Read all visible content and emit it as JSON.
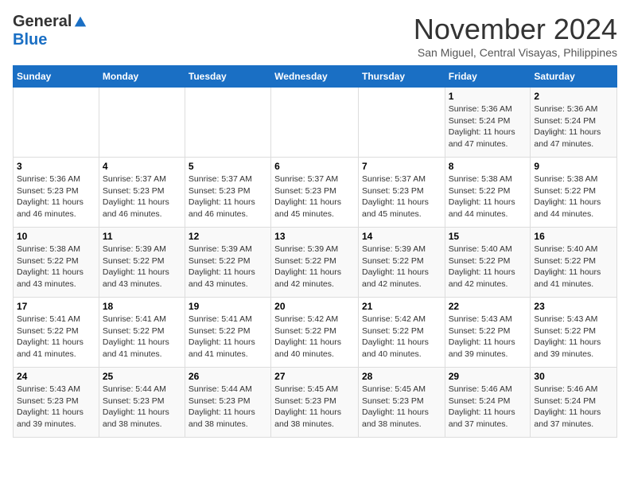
{
  "logo": {
    "general": "General",
    "blue": "Blue"
  },
  "title": "November 2024",
  "subtitle": "San Miguel, Central Visayas, Philippines",
  "days_header": [
    "Sunday",
    "Monday",
    "Tuesday",
    "Wednesday",
    "Thursday",
    "Friday",
    "Saturday"
  ],
  "weeks": [
    [
      {
        "day": "",
        "info": ""
      },
      {
        "day": "",
        "info": ""
      },
      {
        "day": "",
        "info": ""
      },
      {
        "day": "",
        "info": ""
      },
      {
        "day": "",
        "info": ""
      },
      {
        "day": "1",
        "info": "Sunrise: 5:36 AM\nSunset: 5:24 PM\nDaylight: 11 hours\nand 47 minutes."
      },
      {
        "day": "2",
        "info": "Sunrise: 5:36 AM\nSunset: 5:24 PM\nDaylight: 11 hours\nand 47 minutes."
      }
    ],
    [
      {
        "day": "3",
        "info": "Sunrise: 5:36 AM\nSunset: 5:23 PM\nDaylight: 11 hours\nand 46 minutes."
      },
      {
        "day": "4",
        "info": "Sunrise: 5:37 AM\nSunset: 5:23 PM\nDaylight: 11 hours\nand 46 minutes."
      },
      {
        "day": "5",
        "info": "Sunrise: 5:37 AM\nSunset: 5:23 PM\nDaylight: 11 hours\nand 46 minutes."
      },
      {
        "day": "6",
        "info": "Sunrise: 5:37 AM\nSunset: 5:23 PM\nDaylight: 11 hours\nand 45 minutes."
      },
      {
        "day": "7",
        "info": "Sunrise: 5:37 AM\nSunset: 5:23 PM\nDaylight: 11 hours\nand 45 minutes."
      },
      {
        "day": "8",
        "info": "Sunrise: 5:38 AM\nSunset: 5:22 PM\nDaylight: 11 hours\nand 44 minutes."
      },
      {
        "day": "9",
        "info": "Sunrise: 5:38 AM\nSunset: 5:22 PM\nDaylight: 11 hours\nand 44 minutes."
      }
    ],
    [
      {
        "day": "10",
        "info": "Sunrise: 5:38 AM\nSunset: 5:22 PM\nDaylight: 11 hours\nand 43 minutes."
      },
      {
        "day": "11",
        "info": "Sunrise: 5:39 AM\nSunset: 5:22 PM\nDaylight: 11 hours\nand 43 minutes."
      },
      {
        "day": "12",
        "info": "Sunrise: 5:39 AM\nSunset: 5:22 PM\nDaylight: 11 hours\nand 43 minutes."
      },
      {
        "day": "13",
        "info": "Sunrise: 5:39 AM\nSunset: 5:22 PM\nDaylight: 11 hours\nand 42 minutes."
      },
      {
        "day": "14",
        "info": "Sunrise: 5:39 AM\nSunset: 5:22 PM\nDaylight: 11 hours\nand 42 minutes."
      },
      {
        "day": "15",
        "info": "Sunrise: 5:40 AM\nSunset: 5:22 PM\nDaylight: 11 hours\nand 42 minutes."
      },
      {
        "day": "16",
        "info": "Sunrise: 5:40 AM\nSunset: 5:22 PM\nDaylight: 11 hours\nand 41 minutes."
      }
    ],
    [
      {
        "day": "17",
        "info": "Sunrise: 5:41 AM\nSunset: 5:22 PM\nDaylight: 11 hours\nand 41 minutes."
      },
      {
        "day": "18",
        "info": "Sunrise: 5:41 AM\nSunset: 5:22 PM\nDaylight: 11 hours\nand 41 minutes."
      },
      {
        "day": "19",
        "info": "Sunrise: 5:41 AM\nSunset: 5:22 PM\nDaylight: 11 hours\nand 41 minutes."
      },
      {
        "day": "20",
        "info": "Sunrise: 5:42 AM\nSunset: 5:22 PM\nDaylight: 11 hours\nand 40 minutes."
      },
      {
        "day": "21",
        "info": "Sunrise: 5:42 AM\nSunset: 5:22 PM\nDaylight: 11 hours\nand 40 minutes."
      },
      {
        "day": "22",
        "info": "Sunrise: 5:43 AM\nSunset: 5:22 PM\nDaylight: 11 hours\nand 39 minutes."
      },
      {
        "day": "23",
        "info": "Sunrise: 5:43 AM\nSunset: 5:22 PM\nDaylight: 11 hours\nand 39 minutes."
      }
    ],
    [
      {
        "day": "24",
        "info": "Sunrise: 5:43 AM\nSunset: 5:23 PM\nDaylight: 11 hours\nand 39 minutes."
      },
      {
        "day": "25",
        "info": "Sunrise: 5:44 AM\nSunset: 5:23 PM\nDaylight: 11 hours\nand 38 minutes."
      },
      {
        "day": "26",
        "info": "Sunrise: 5:44 AM\nSunset: 5:23 PM\nDaylight: 11 hours\nand 38 minutes."
      },
      {
        "day": "27",
        "info": "Sunrise: 5:45 AM\nSunset: 5:23 PM\nDaylight: 11 hours\nand 38 minutes."
      },
      {
        "day": "28",
        "info": "Sunrise: 5:45 AM\nSunset: 5:23 PM\nDaylight: 11 hours\nand 38 minutes."
      },
      {
        "day": "29",
        "info": "Sunrise: 5:46 AM\nSunset: 5:24 PM\nDaylight: 11 hours\nand 37 minutes."
      },
      {
        "day": "30",
        "info": "Sunrise: 5:46 AM\nSunset: 5:24 PM\nDaylight: 11 hours\nand 37 minutes."
      }
    ]
  ]
}
